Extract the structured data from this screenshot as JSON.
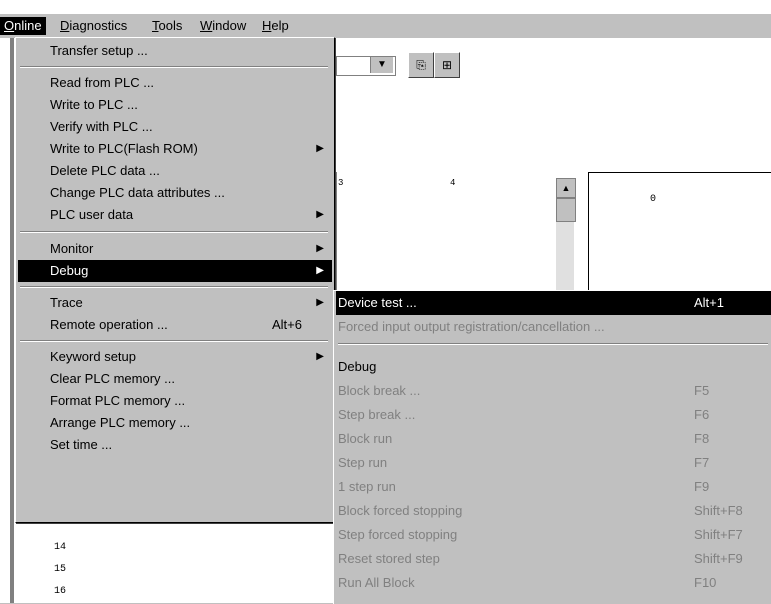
{
  "menubar": [
    {
      "label": "Online",
      "active": true
    },
    {
      "label": "Diagnostics"
    },
    {
      "label": "Tools"
    },
    {
      "label": "Window"
    },
    {
      "label": "Help"
    }
  ],
  "online_menu": [
    {
      "label": "Transfer setup ...",
      "arrow": false,
      "shortcut": ""
    },
    {
      "label": "Read from PLC ...",
      "arrow": false,
      "shortcut": ""
    },
    {
      "label": "Write to PLC ...",
      "arrow": false,
      "shortcut": ""
    },
    {
      "label": "Verify with PLC ...",
      "arrow": false,
      "shortcut": ""
    },
    {
      "label": "Write to PLC(Flash ROM)",
      "arrow": true,
      "shortcut": ""
    },
    {
      "label": "Delete PLC data ...",
      "arrow": false,
      "shortcut": ""
    },
    {
      "label": "Change PLC data attributes ...",
      "arrow": false,
      "shortcut": ""
    },
    {
      "label": "PLC user data",
      "arrow": true,
      "shortcut": ""
    },
    {
      "label": "Monitor",
      "arrow": true,
      "shortcut": ""
    },
    {
      "label": "Debug",
      "arrow": true,
      "shortcut": "",
      "highlighted": true
    },
    {
      "label": "Trace",
      "arrow": true,
      "shortcut": ""
    },
    {
      "label": "Remote operation ...",
      "arrow": false,
      "shortcut": "Alt+6"
    },
    {
      "label": "Keyword setup",
      "arrow": true,
      "shortcut": ""
    },
    {
      "label": "Clear PLC memory ...",
      "arrow": false,
      "shortcut": ""
    },
    {
      "label": "Format PLC memory ...",
      "arrow": false,
      "shortcut": ""
    },
    {
      "label": "Arrange PLC memory ...",
      "arrow": false,
      "shortcut": ""
    },
    {
      "label": "Set time ...",
      "arrow": false,
      "shortcut": ""
    }
  ],
  "debug_submenu": [
    {
      "label": "Device test ...",
      "shortcut": "Alt+1",
      "highlighted": true
    },
    {
      "label": "Forced input output registration/cancellation ...",
      "shortcut": "",
      "disabled": true
    },
    {
      "label": "Debug",
      "shortcut": ""
    },
    {
      "label": "Block break ...",
      "shortcut": "F5",
      "disabled": true
    },
    {
      "label": "Step break ...",
      "shortcut": "F6",
      "disabled": true
    },
    {
      "label": "Block run",
      "shortcut": "F8",
      "disabled": true
    },
    {
      "label": "Step run",
      "shortcut": "F7",
      "disabled": true
    },
    {
      "label": "1 step run",
      "shortcut": "F9",
      "disabled": true
    },
    {
      "label": "Block forced stopping",
      "shortcut": "Shift+F8",
      "disabled": true
    },
    {
      "label": "Step forced stopping",
      "shortcut": "Shift+F7",
      "disabled": true
    },
    {
      "label": "Reset stored step",
      "shortcut": "Shift+F9",
      "disabled": true
    },
    {
      "label": "Run All Block",
      "shortcut": "F10",
      "disabled": true
    }
  ],
  "background": {
    "col3": "3",
    "col4": "4",
    "right_value": "0",
    "rows": [
      "14",
      "15",
      "16"
    ]
  }
}
